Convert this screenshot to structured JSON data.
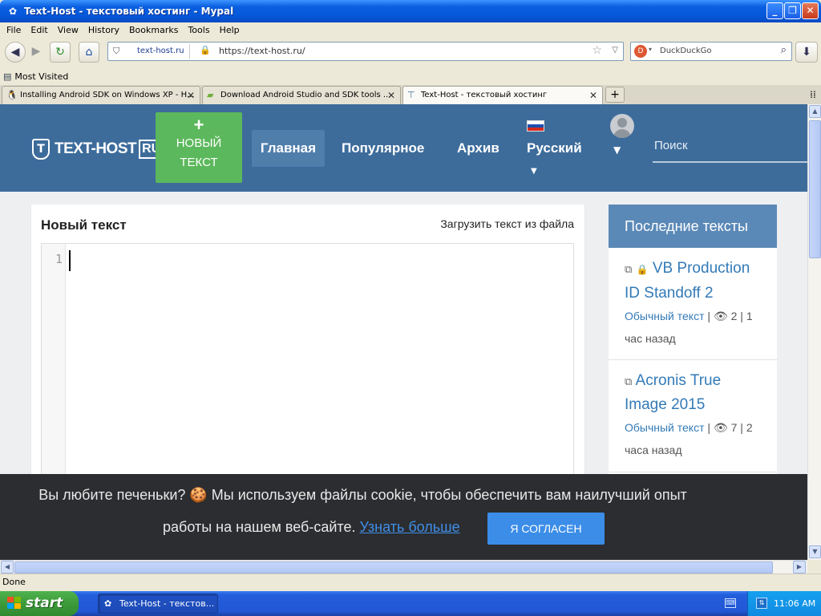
{
  "window": {
    "title": "Text-Host - текстовый хостинг - Mypal",
    "icon": "mypal-icon",
    "min_label": "_",
    "max_label": "❐",
    "close_label": "✕"
  },
  "menu": [
    "File",
    "Edit",
    "View",
    "History",
    "Bookmarks",
    "Tools",
    "Help"
  ],
  "navbar": {
    "site_identity": "text-host.ru",
    "url": "https://text-host.ru/",
    "search_placeholder": "DuckDuckGo"
  },
  "bookmarks": {
    "most_visited": "Most Visited"
  },
  "tabs": [
    {
      "title": "Installing Android SDK on Windows XP - H...",
      "icon": "tux-icon"
    },
    {
      "title": "Download Android Studio and SDK tools  ...",
      "icon": "android-icon"
    },
    {
      "title": "Text-Host - текстовый хостинг",
      "icon": "text-host-icon"
    }
  ],
  "site": {
    "logo_text": "TEXT-HOST",
    "logo_ru": "RU",
    "logo_badge": "T",
    "new_btn_plus": "+",
    "new_btn_l1": "НОВЫЙ",
    "new_btn_l2": "ТЕКСТ",
    "nav": [
      "Главная",
      "Популярное",
      "Архив"
    ],
    "language": "Русский",
    "search_placeholder": "Поиск",
    "flag_colors": [
      "#ffffff",
      "#1c4fb0",
      "#d52b1e"
    ],
    "accent_blue": "#3d6c9b",
    "green": "#5cb85c"
  },
  "editor": {
    "title": "Новый текст",
    "load_link": "Загрузить текст из файла",
    "line_number": "1"
  },
  "recent": {
    "title": "Последние тексты",
    "items": [
      {
        "title": "VB Production ID Standoff 2",
        "type": "Обычный текст",
        "sep1": "|",
        "views": "2",
        "sep2": "|",
        "time": "1 час назад",
        "locked": true
      },
      {
        "title": "Acronis True Image 2015",
        "type": "Обычный текст",
        "sep1": "|",
        "views": "7",
        "sep2": "|",
        "time": "2 часа назад",
        "locked": false
      }
    ]
  },
  "cookie": {
    "text1": "Вы любите печеньки? 🍪 Мы используем файлы cookie, чтобы обеспечить вам наилучший опыт",
    "text2": "работы на нашем веб-сайте.",
    "more": "Узнать больше",
    "button": "Я СОГЛАСЕН"
  },
  "status": "Done",
  "taskbar": {
    "start": "start",
    "item": "Text-Host - текстов...",
    "clock": "11:06 AM"
  }
}
